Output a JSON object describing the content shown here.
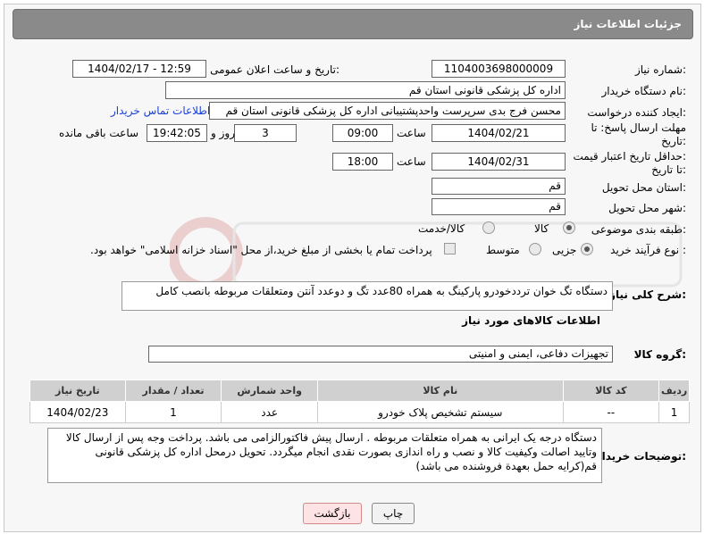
{
  "header": {
    "title": "جزئیات اطلاعات نیاز"
  },
  "fields": {
    "need_number": {
      "label": "شماره نیاز:",
      "value": "1104003698000009"
    },
    "announce": {
      "label": "تاریخ و ساعت اعلان عمومی:",
      "value": "1404/02/17 - 12:59"
    },
    "buyer": {
      "label": "نام دستگاه خریدار:",
      "value": "اداره کل پزشکی قانونی استان قم"
    },
    "creator": {
      "label": "ایجاد کننده درخواست:",
      "value": "محسن فرج بدی سرپرست واحدپشتیبانی اداره کل پزشکی قانونی استان قم",
      "contact_link": "اطلاعات تماس خریدار"
    },
    "deadline": {
      "label_line1": "مهلت ارسال پاسخ: تا",
      "label_line2": "تاریخ:",
      "date": "1404/02/21",
      "time_label": "ساعت",
      "time": "09:00",
      "days": "3",
      "days_label": "روز و",
      "remaining": "19:42:05",
      "remaining_label": "ساعت باقی مانده"
    },
    "validity": {
      "label_line1": "حداقل تاریخ اعتبار قیمت:",
      "label_line2": "تا تاریخ:",
      "date": "1404/02/31",
      "time_label": "ساعت",
      "time": "18:00"
    },
    "province": {
      "label": "استان محل تحویل:",
      "value": "قم"
    },
    "city": {
      "label": "شهر محل تحویل:",
      "value": "قم"
    },
    "category": {
      "label": "طبقه بندی موضوعی:",
      "options": [
        "کالا",
        "کالا/خدمت"
      ],
      "selected": "کالا"
    },
    "process": {
      "label": "نوع فرآیند خرید :",
      "options": [
        "جزیی",
        "متوسط"
      ],
      "selected": "جزیی",
      "payment_note": "پرداخت تمام یا بخشی از مبلغ خرید،از محل \"اسناد خزانه اسلامی\" خواهد بود."
    }
  },
  "description": {
    "label": "شرح کلی نیاز:",
    "value": "دستگاه تگ خوان ترددخودرو پارکینگ به همراه 80عدد تگ و دوعدد آنتن ومتعلقات مربوطه بانصب کامل"
  },
  "goods": {
    "section_title": "اطلاعات کالاهای مورد نیاز",
    "group_label": "گروه کالا:",
    "group_value": "تجهیزات دفاعی، ایمنی و امنیتی",
    "columns": [
      "ردیف",
      "کد کالا",
      "نام کالا",
      "واحد شمارش",
      "تعداد / مقدار",
      "تاریخ نیاز"
    ],
    "rows": [
      {
        "row": "1",
        "code": "--",
        "name": "سیستم تشخیص پلاک خودرو",
        "unit": "عدد",
        "qty": "1",
        "date": "1404/02/23"
      }
    ]
  },
  "buyer_notes": {
    "label": "توضیحات خریدار:",
    "value": "دستگاه درجه یک ایرانی به همراه متعلقات مربوطه . ارسال پیش فاکتورالزامی می باشد. پرداخت وجه پس از ارسال کالا وتایید اصالت وکیفیت کالا و نصب و راه اندازی بصورت نقدی انجام میگردد. تحویل درمحل اداره کل پزشکی قانونی قم(کرایه حمل بعهدة فروشنده می باشد)"
  },
  "buttons": {
    "print": "چاپ",
    "back": "بازگشت"
  },
  "colors": {
    "header_bg": "#8a8a8a",
    "link": "#1a3fd6",
    "back_button_bg": "#fde3e3"
  }
}
